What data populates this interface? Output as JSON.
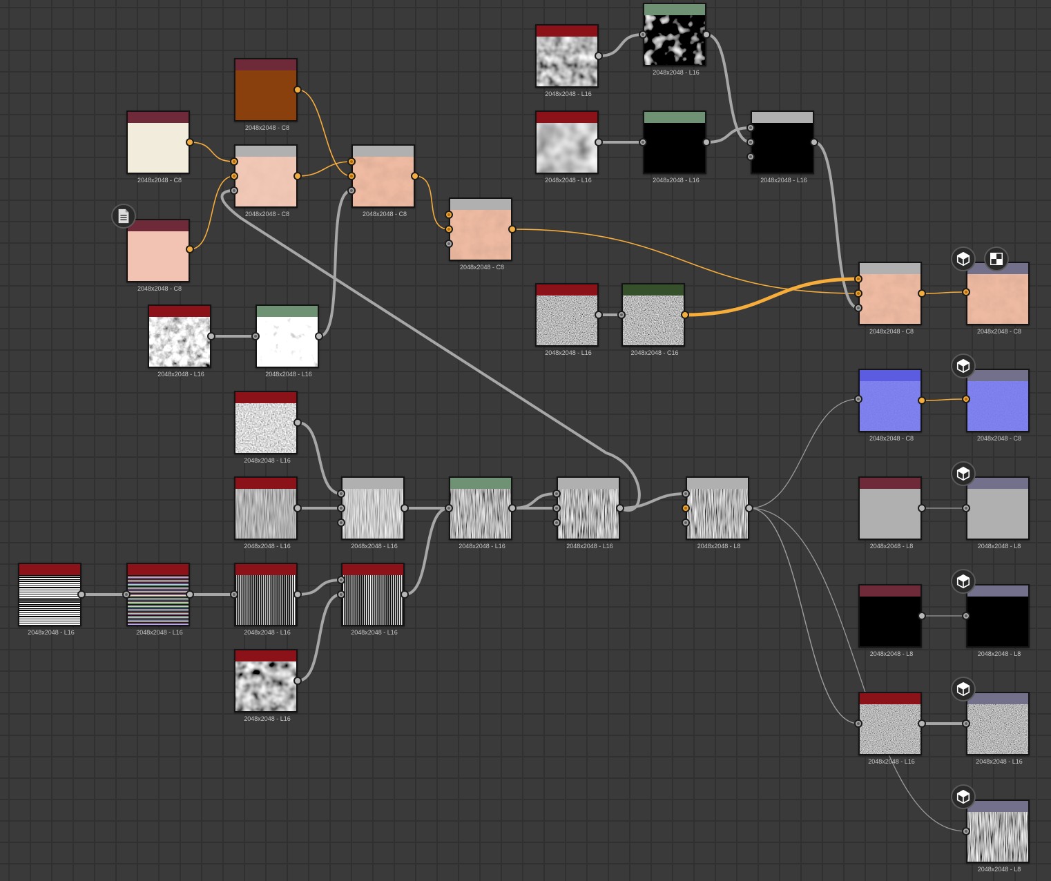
{
  "app": {
    "view": "graph-editor"
  },
  "colors": {
    "hdr_input_red": "#8a1218",
    "hdr_color_maroon": "#6e2a38",
    "hdr_gray": "#b0b0b0",
    "hdr_green": "#6f9274",
    "hdr_dark_green": "#35502a",
    "hdr_output": "#72708a",
    "wire_gray": "#a7a7a7",
    "wire_orange": "#f6ad3c"
  },
  "nodes": [
    {
      "id": "n_brown",
      "label": "2048x2048 - C8",
      "header": "maroon",
      "thumb": "brown"
    },
    {
      "id": "n_cream",
      "label": "2048x2048 - C8",
      "header": "maroon",
      "thumb": "cream"
    },
    {
      "id": "n_pink",
      "label": "2048x2048 - C8",
      "header": "maroon",
      "thumb": "pink",
      "badge": "document-icon"
    },
    {
      "id": "n_blend1",
      "label": "2048x2048 - C8",
      "header": "gray",
      "thumb": "skin-light"
    },
    {
      "id": "n_blend2",
      "label": "2048x2048 - C8",
      "header": "gray",
      "thumb": "skin"
    },
    {
      "id": "n_blend3",
      "label": "2048x2048 - C8",
      "header": "gray",
      "thumb": "skin"
    },
    {
      "id": "n_grunge_a",
      "label": "2048x2048 - L16",
      "header": "red",
      "thumb": "grunge"
    },
    {
      "id": "n_grunge_b",
      "label": "2048x2048 - L16",
      "header": "green",
      "thumb": "grunge-light"
    },
    {
      "id": "n_cloud1",
      "label": "2048x2048 - L16",
      "header": "red",
      "thumb": "clouds"
    },
    {
      "id": "n_blobs",
      "label": "2048x2048 - L16",
      "header": "green",
      "thumb": "blobs"
    },
    {
      "id": "n_cloud2",
      "label": "2048x2048 - L16",
      "header": "red",
      "thumb": "clouds-soft"
    },
    {
      "id": "n_spots",
      "label": "2048x2048 - L16",
      "header": "green",
      "thumb": "black-spots"
    },
    {
      "id": "n_mask",
      "label": "2048x2048 - L16",
      "header": "gray",
      "thumb": "black-spots"
    },
    {
      "id": "n_grain1",
      "label": "2048x2048 - L16",
      "header": "red",
      "thumb": "grain"
    },
    {
      "id": "n_grain2",
      "label": "2048x2048 - C16",
      "header": "dark-green",
      "thumb": "grain"
    },
    {
      "id": "n_basecolor",
      "label": "2048x2048 - C8",
      "header": "gray",
      "thumb": "skin"
    },
    {
      "id": "n_out_base",
      "label": "2048x2048 - C8",
      "header": "output",
      "thumb": "skin",
      "badge": "cube-icon",
      "badge2": "checker-icon"
    },
    {
      "id": "n_normal",
      "label": "2048x2048 - C8",
      "header": "normal",
      "thumb": "normal"
    },
    {
      "id": "n_out_normal",
      "label": "2048x2048 - C8",
      "header": "output",
      "thumb": "normal",
      "badge": "cube-icon"
    },
    {
      "id": "n_rough_in",
      "label": "2048x2048 - L8",
      "header": "maroon",
      "thumb": "gray-flat"
    },
    {
      "id": "n_out_rough",
      "label": "2048x2048 - L8",
      "header": "output",
      "thumb": "gray-flat",
      "badge": "cube-icon"
    },
    {
      "id": "n_metal_in",
      "label": "2048x2048 - L8",
      "header": "maroon",
      "thumb": "black"
    },
    {
      "id": "n_out_metal",
      "label": "2048x2048 - L8",
      "header": "output",
      "thumb": "black",
      "badge": "cube-icon"
    },
    {
      "id": "n_height",
      "label": "2048x2048 - L16",
      "header": "red",
      "thumb": "grain-fine"
    },
    {
      "id": "n_out_height",
      "label": "2048x2048 - L16",
      "header": "output",
      "thumb": "grain-fine",
      "badge": "cube-icon"
    },
    {
      "id": "n_out_ao",
      "label": "2048x2048 - L8",
      "header": "output",
      "thumb": "vstreak",
      "badge": "cube-icon"
    },
    {
      "id": "n_noise1",
      "label": "2048x2048 - L16",
      "header": "red",
      "thumb": "noise"
    },
    {
      "id": "n_streak1",
      "label": "2048x2048 - L16",
      "header": "red",
      "thumb": "vstreak-dark"
    },
    {
      "id": "n_mix1",
      "label": "2048x2048 - L16",
      "header": "gray",
      "thumb": "vstreak-mid"
    },
    {
      "id": "n_mix2",
      "label": "2048x2048 - L16",
      "header": "green",
      "thumb": "vstreak"
    },
    {
      "id": "n_mix3",
      "label": "2048x2048 - L16",
      "header": "gray",
      "thumb": "vstreak"
    },
    {
      "id": "n_mix4",
      "label": "2048x2048 - L8",
      "header": "gray",
      "thumb": "vstreak"
    },
    {
      "id": "n_lines1",
      "label": "2048x2048 - L16",
      "header": "red",
      "thumb": "hlines"
    },
    {
      "id": "n_lines2",
      "label": "2048x2048 - L16",
      "header": "red",
      "thumb": "hlines-thin"
    },
    {
      "id": "n_lines3",
      "label": "2048x2048 - L16",
      "header": "red",
      "thumb": "vlines"
    },
    {
      "id": "n_lines4",
      "label": "2048x2048 - L16",
      "header": "red",
      "thumb": "vlines"
    },
    {
      "id": "n_cloud3",
      "label": "2048x2048 - L16",
      "header": "red",
      "thumb": "clouds"
    }
  ]
}
